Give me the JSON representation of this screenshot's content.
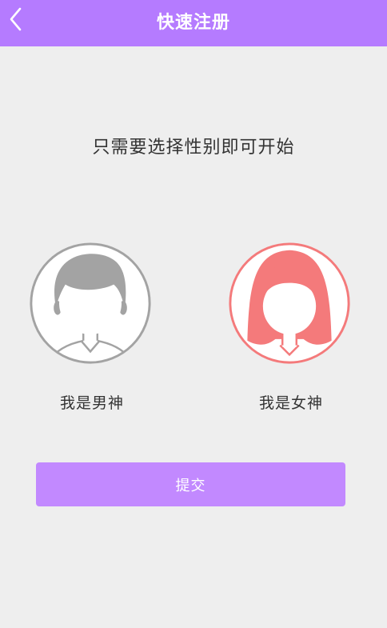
{
  "header": {
    "title": "快速注册",
    "back_icon": "chevron-left-icon",
    "background_color": "#b57bff"
  },
  "prompt": "只需要选择性别即可开始",
  "genders": [
    {
      "label": "我是男神",
      "icon": "male-avatar-icon",
      "color": "#a3a3a3"
    },
    {
      "label": "我是女神",
      "icon": "female-avatar-icon",
      "color": "#f47a7b"
    }
  ],
  "submit": {
    "label": "提交",
    "color": "#c289ff"
  }
}
